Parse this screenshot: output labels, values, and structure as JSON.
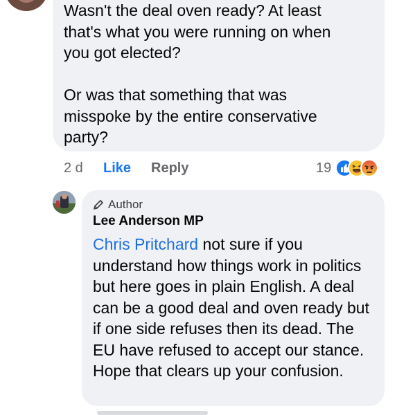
{
  "comment1": {
    "text": "Wasn't the deal oven ready? At least\nthat's what you were running on when\nyou got elected?\n\nOr was that something that was\nmisspoke by the entire conservative\nparty?",
    "time": "2 d",
    "like_label": "Like",
    "reply_label": "Reply",
    "reaction_count": "19",
    "reactions": [
      "like-icon",
      "haha-icon",
      "angry-icon"
    ]
  },
  "reply": {
    "author_badge": "Author",
    "author_name": "Lee Anderson MP",
    "mention": "Chris Pritchard",
    "text": " not sure if you understand how things work in politics but here goes in plain English. A deal can be a good deal and oven ready but if one side refuses then its dead. The EU have refused to accept our stance. Hope that clears up your confusion."
  },
  "colors": {
    "bubble": "#eff1f5",
    "link_blue": "#1877f2",
    "mention_blue": "#1f6fdd",
    "muted": "#65676b"
  }
}
